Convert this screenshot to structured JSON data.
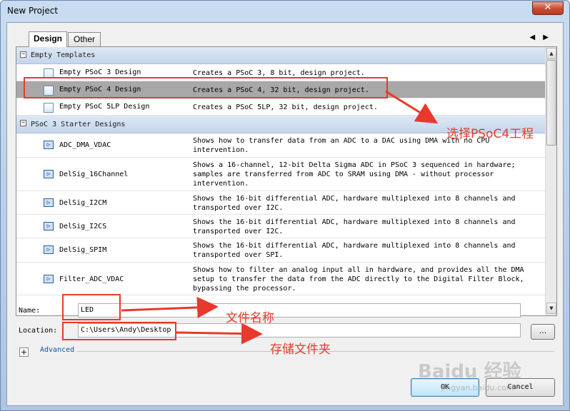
{
  "window": {
    "title": "New Project",
    "close_label": "✕"
  },
  "tabs": [
    {
      "label": "Design"
    },
    {
      "label": "Other"
    }
  ],
  "tab_arrows": "◀ ▶",
  "templates": {
    "empty_group": "Empty Templates",
    "empty_items": [
      {
        "name": "Empty PSoC 3 Design",
        "desc": "Creates a PSoC 3, 8 bit, design project."
      },
      {
        "name": "Empty PSoC 4 Design",
        "desc": "Creates a PSoC 4, 32 bit, design project."
      },
      {
        "name": "Empty PSoC 5LP Design",
        "desc": "Creates a PSoC 5LP, 32 bit, design project."
      }
    ],
    "starter_group": "PSoC 3 Starter Designs",
    "starter_items": [
      {
        "name": "ADC_DMA_VDAC",
        "desc": "Shows how to transfer data from an ADC to a DAC using DMA with no CPU intervention."
      },
      {
        "name": "DelSig_16Channel",
        "desc": "Shows a 16-channel, 12-bit Delta Sigma ADC in PSoC 3 sequenced in hardware; samples are transferred from ADC to SRAM using DMA - without processor intervention."
      },
      {
        "name": "DelSig_I2CM",
        "desc": "Shows the 16-bit differential ADC, hardware multiplexed into 8 channels and transported over I2C."
      },
      {
        "name": "DelSig_I2CS",
        "desc": "Shows the 16-bit differential ADC, hardware multiplexed into 8 channels and transported over I2C."
      },
      {
        "name": "DelSig_SPIM",
        "desc": "Shows the 16-bit differential ADC, hardware multiplexed into 8 channels and transported over SPI."
      },
      {
        "name": "Filter_ADC_VDAC",
        "desc": "Shows how to filter an analog input all in hardware, and provides all the DMA setup to transfer the data from the ADC directly to the Digital Filter Block, bypassing the processor."
      }
    ]
  },
  "form": {
    "name_label": "Name:",
    "name_value": "LED",
    "location_label": "Location:",
    "location_value": "C:\\Users\\Andy\\Desktop",
    "browse_label": "...",
    "expander": "+",
    "advanced_label": "Advanced"
  },
  "buttons": {
    "ok": "OK",
    "cancel": "Cancel"
  },
  "annotations": {
    "select": "选择PSoC4工程",
    "filename": "文件名称",
    "folder": "存储文件夹"
  },
  "watermark": {
    "logo": "Baidu 经验",
    "url": "jingyan.baidu.com"
  }
}
